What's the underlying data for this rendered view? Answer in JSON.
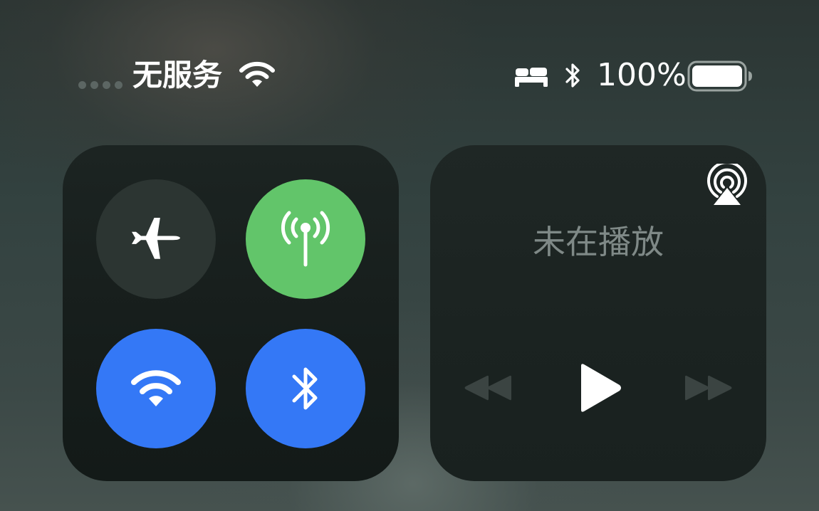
{
  "status_bar": {
    "carrier": "无服务",
    "battery_percent": "100%",
    "battery_level": 1.0,
    "icons": [
      "signal-dots-icon",
      "wifi-icon",
      "bed-icon",
      "bluetooth-icon",
      "battery-icon"
    ]
  },
  "connectivity": {
    "toggles": [
      {
        "name": "airplane-mode",
        "icon": "airplane-icon",
        "state": "off",
        "color": "#2c3532"
      },
      {
        "name": "cellular-data",
        "icon": "antenna-icon",
        "state": "on",
        "color": "#62c56a"
      },
      {
        "name": "wifi",
        "icon": "wifi-icon",
        "state": "on",
        "color": "#3478f6"
      },
      {
        "name": "bluetooth",
        "icon": "bluetooth-icon",
        "state": "on",
        "color": "#3478f6"
      }
    ]
  },
  "media": {
    "title": "未在播放",
    "airplay_icon": "airplay-audio-icon",
    "controls": [
      "rewind-icon",
      "play-icon",
      "fast-forward-icon"
    ]
  },
  "colors": {
    "accent_blue": "#3478f6",
    "accent_green": "#62c56a",
    "panel_bg": "#1a2220",
    "text_dim": "#7f8987"
  }
}
